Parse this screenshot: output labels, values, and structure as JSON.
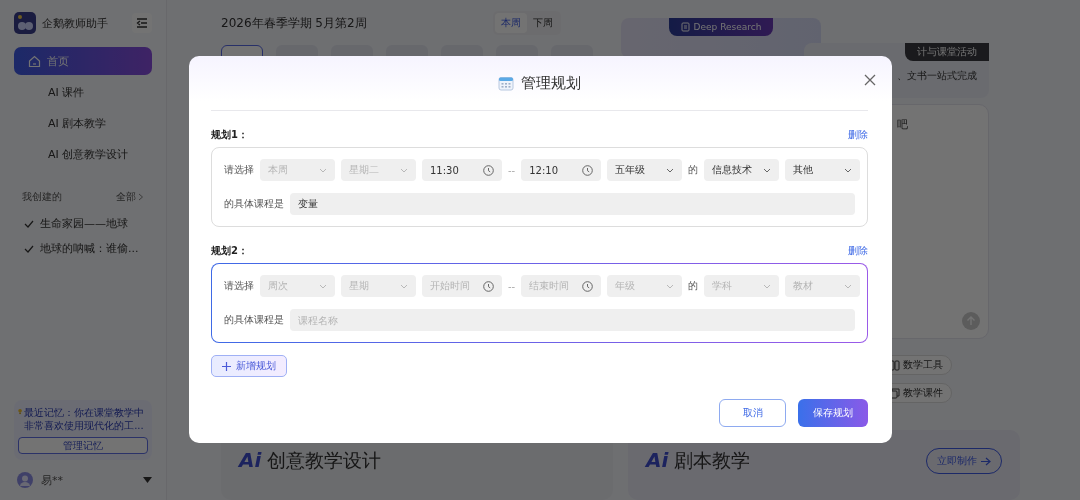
{
  "sidebar": {
    "app_name": "企鹅教师助手",
    "nav": [
      {
        "label": "首页",
        "selected": true
      },
      {
        "label": "AI 课件",
        "selected": false
      },
      {
        "label": "AI 剧本教学",
        "selected": false
      },
      {
        "label": "AI 创意教学设计",
        "selected": false
      }
    ],
    "section_title": "我创建的",
    "section_link": "全部",
    "created": [
      {
        "label": "生命家园——地球"
      },
      {
        "label": "地球的呐喊：谁偷..."
      }
    ],
    "memory": {
      "text": "最近记忆：你在课堂教学中非常喜欢使用现代化的工...",
      "button": "管理记忆"
    },
    "user": "易**"
  },
  "header": {
    "term": "2026年春季学期 5月第2周",
    "week_tabs": [
      {
        "label": "本周",
        "selected": true
      },
      {
        "label": "下周",
        "selected": false
      }
    ],
    "day_pills": [
      {
        "selected": true
      },
      {
        "selected": false
      },
      {
        "selected": false
      },
      {
        "selected": false
      },
      {
        "selected": false
      },
      {
        "selected": false
      },
      {
        "selected": false
      }
    ]
  },
  "background": {
    "deep_research": "Deep Research",
    "activity_tab": "计与课堂活动",
    "activity_subtitle": "、文书一站式完成",
    "chat_hint": "吧",
    "tools": [
      {
        "label": "数学工具"
      },
      {
        "label": "教学课件"
      }
    ],
    "features": [
      {
        "logo": "Ai",
        "title": "创意教学设计"
      },
      {
        "logo": "Ai",
        "title": "剧本教学",
        "button": "立即制作"
      }
    ]
  },
  "dialog": {
    "title": "管理规划",
    "plans": [
      {
        "label": "规划1：",
        "delete": "删除",
        "active": false,
        "prompt": "请选择",
        "connector": "--",
        "of": "的",
        "course_label": "的具体课程是",
        "course": {
          "value": "变量"
        },
        "fields": [
          {
            "kind": "select",
            "value": "本周",
            "disabled": true
          },
          {
            "kind": "select",
            "value": "星期二",
            "disabled": true
          },
          {
            "kind": "time",
            "value": "11:30",
            "disabled": false
          },
          {
            "kind": "time",
            "value": "12:10",
            "disabled": false
          },
          {
            "kind": "select",
            "value": "五年级",
            "disabled": false
          },
          {
            "kind": "select",
            "value": "信息技术",
            "disabled": false
          },
          {
            "kind": "select",
            "value": "其他",
            "disabled": false
          }
        ]
      },
      {
        "label": "规划2：",
        "delete": "删除",
        "active": true,
        "prompt": "请选择",
        "connector": "--",
        "of": "的",
        "course_label": "的具体课程是",
        "course": {
          "placeholder": "课程名称"
        },
        "fields": [
          {
            "kind": "select",
            "placeholder": "周次"
          },
          {
            "kind": "select",
            "placeholder": "星期"
          },
          {
            "kind": "time",
            "placeholder": "开始时间"
          },
          {
            "kind": "time",
            "placeholder": "结束时间"
          },
          {
            "kind": "select",
            "placeholder": "年级"
          },
          {
            "kind": "select",
            "placeholder": "学科"
          },
          {
            "kind": "select",
            "placeholder": "教材"
          }
        ]
      }
    ],
    "add_button": "新增规划",
    "cancel": "取消",
    "save": "保存规划"
  }
}
